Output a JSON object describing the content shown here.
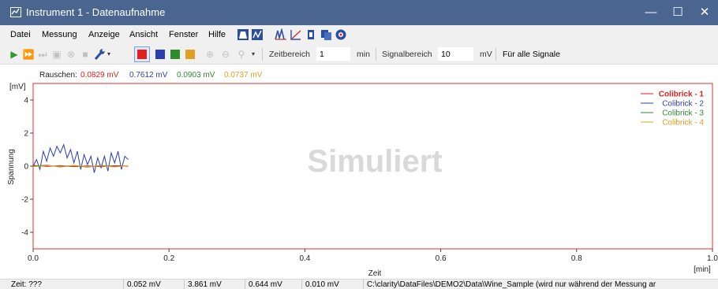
{
  "window": {
    "title": "Instrument 1 - Datenaufnahme",
    "minimize_glyph": "—",
    "maximize_glyph": "☐",
    "close_glyph": "✕"
  },
  "menu": {
    "items": [
      "Datei",
      "Messung",
      "Anzeige",
      "Ansicht",
      "Fenster",
      "Hilfe"
    ]
  },
  "toolbar": {
    "zeitbereich_label": "Zeitbereich",
    "zeitbereich_value": "1",
    "zeitbereich_unit": "min",
    "signalbereich_label": "Signalbereich",
    "signalbereich_value": "10",
    "signalbereich_unit": "mV",
    "fuer_alle_label": "Für alle Signale",
    "swatch_colors": [
      "#e02020",
      "#2b3fb0",
      "#2e8b2e",
      "#e0a020"
    ]
  },
  "noise": {
    "label": "Rauschen:",
    "values": [
      {
        "text": "0.0829 mV",
        "color": "#e02020"
      },
      {
        "text": "0.7612 mV",
        "color": "#2b3fb0"
      },
      {
        "text": "0.0903 mV",
        "color": "#2e8b2e"
      },
      {
        "text": "0.0737 mV",
        "color": "#e0a020"
      }
    ]
  },
  "chart_data": {
    "type": "line",
    "ylabel": "Spannung",
    "yunit": "[mV]",
    "xlabel": "Zeit",
    "xunit": "[min]",
    "watermark": "Simuliert",
    "xlim": [
      0,
      1.0
    ],
    "ylim": [
      -5,
      5
    ],
    "x_ticks": [
      "0.0",
      "0.2",
      "0.4",
      "0.6",
      "0.8",
      "1.0"
    ],
    "x_tick_values": [
      0,
      0.2,
      0.4,
      0.6,
      0.8,
      1.0
    ],
    "y_ticks": [
      "4",
      "2",
      "0",
      "-2",
      "-4"
    ],
    "y_tick_values": [
      4,
      2,
      0,
      -2,
      -4
    ],
    "legend_position": "top-right",
    "series": [
      {
        "name": "Colibrick - 1",
        "color": "#e02020",
        "bold": true,
        "x": [
          0.0,
          0.02,
          0.04,
          0.06,
          0.08,
          0.1,
          0.12,
          0.14
        ],
        "y": [
          0.05,
          -0.02,
          0.04,
          -0.03,
          0.02,
          -0.04,
          0.03,
          0.0
        ]
      },
      {
        "name": "Colibrick - 2",
        "color": "#2b3fb0",
        "bold": false,
        "x": [
          0.0,
          0.005,
          0.01,
          0.015,
          0.02,
          0.025,
          0.03,
          0.035,
          0.04,
          0.045,
          0.05,
          0.055,
          0.06,
          0.065,
          0.07,
          0.075,
          0.08,
          0.085,
          0.09,
          0.095,
          0.1,
          0.105,
          0.11,
          0.115,
          0.12,
          0.125,
          0.13,
          0.135,
          0.14
        ],
        "y": [
          0.0,
          0.4,
          -0.2,
          0.9,
          0.3,
          1.1,
          0.6,
          1.2,
          0.8,
          1.3,
          0.5,
          1.0,
          0.2,
          0.9,
          -0.2,
          0.7,
          0.1,
          0.6,
          -0.4,
          0.5,
          -0.1,
          0.6,
          -0.3,
          0.8,
          0.2,
          0.9,
          -0.2,
          0.6,
          0.4
        ]
      },
      {
        "name": "Colibrick - 3",
        "color": "#2e8b2e",
        "bold": false,
        "x": [
          0.0,
          0.02,
          0.04,
          0.06,
          0.08,
          0.1,
          0.12,
          0.14
        ],
        "y": [
          0.0,
          0.06,
          -0.05,
          0.04,
          -0.06,
          0.05,
          -0.03,
          0.02
        ]
      },
      {
        "name": "Colibrick - 4",
        "color": "#e0a020",
        "bold": false,
        "x": [
          0.0,
          0.02,
          0.04,
          0.06,
          0.08,
          0.1,
          0.12,
          0.14
        ],
        "y": [
          -0.03,
          0.03,
          -0.02,
          0.05,
          -0.04,
          0.02,
          -0.05,
          0.03
        ]
      }
    ]
  },
  "status": {
    "zeit": "Zeit: ???",
    "values": [
      "0.052 mV",
      "3.861 mV",
      "0.644 mV",
      "0.010 mV"
    ],
    "path": "C:\\clarity\\DataFiles\\DEMO2\\Data\\Wine_Sample (wird nur während der Messung ar"
  }
}
